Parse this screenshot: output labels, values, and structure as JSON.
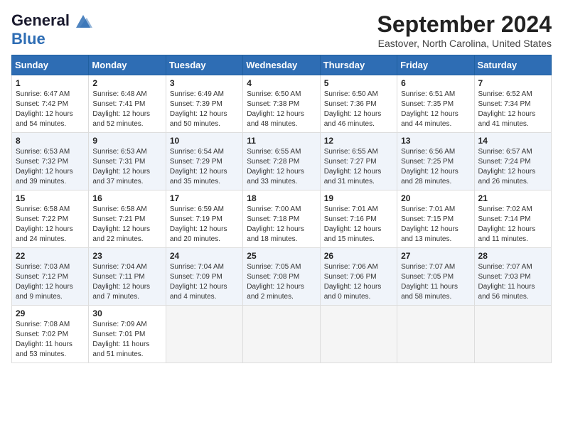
{
  "header": {
    "logo_line1": "General",
    "logo_line2": "Blue",
    "month_year": "September 2024",
    "location": "Eastover, North Carolina, United States"
  },
  "weekdays": [
    "Sunday",
    "Monday",
    "Tuesday",
    "Wednesday",
    "Thursday",
    "Friday",
    "Saturday"
  ],
  "weeks": [
    [
      {
        "day": "1",
        "sunrise": "6:47 AM",
        "sunset": "7:42 PM",
        "daylight": "12 hours and 54 minutes."
      },
      {
        "day": "2",
        "sunrise": "6:48 AM",
        "sunset": "7:41 PM",
        "daylight": "12 hours and 52 minutes."
      },
      {
        "day": "3",
        "sunrise": "6:49 AM",
        "sunset": "7:39 PM",
        "daylight": "12 hours and 50 minutes."
      },
      {
        "day": "4",
        "sunrise": "6:50 AM",
        "sunset": "7:38 PM",
        "daylight": "12 hours and 48 minutes."
      },
      {
        "day": "5",
        "sunrise": "6:50 AM",
        "sunset": "7:36 PM",
        "daylight": "12 hours and 46 minutes."
      },
      {
        "day": "6",
        "sunrise": "6:51 AM",
        "sunset": "7:35 PM",
        "daylight": "12 hours and 44 minutes."
      },
      {
        "day": "7",
        "sunrise": "6:52 AM",
        "sunset": "7:34 PM",
        "daylight": "12 hours and 41 minutes."
      }
    ],
    [
      {
        "day": "8",
        "sunrise": "6:53 AM",
        "sunset": "7:32 PM",
        "daylight": "12 hours and 39 minutes."
      },
      {
        "day": "9",
        "sunrise": "6:53 AM",
        "sunset": "7:31 PM",
        "daylight": "12 hours and 37 minutes."
      },
      {
        "day": "10",
        "sunrise": "6:54 AM",
        "sunset": "7:29 PM",
        "daylight": "12 hours and 35 minutes."
      },
      {
        "day": "11",
        "sunrise": "6:55 AM",
        "sunset": "7:28 PM",
        "daylight": "12 hours and 33 minutes."
      },
      {
        "day": "12",
        "sunrise": "6:55 AM",
        "sunset": "7:27 PM",
        "daylight": "12 hours and 31 minutes."
      },
      {
        "day": "13",
        "sunrise": "6:56 AM",
        "sunset": "7:25 PM",
        "daylight": "12 hours and 28 minutes."
      },
      {
        "day": "14",
        "sunrise": "6:57 AM",
        "sunset": "7:24 PM",
        "daylight": "12 hours and 26 minutes."
      }
    ],
    [
      {
        "day": "15",
        "sunrise": "6:58 AM",
        "sunset": "7:22 PM",
        "daylight": "12 hours and 24 minutes."
      },
      {
        "day": "16",
        "sunrise": "6:58 AM",
        "sunset": "7:21 PM",
        "daylight": "12 hours and 22 minutes."
      },
      {
        "day": "17",
        "sunrise": "6:59 AM",
        "sunset": "7:19 PM",
        "daylight": "12 hours and 20 minutes."
      },
      {
        "day": "18",
        "sunrise": "7:00 AM",
        "sunset": "7:18 PM",
        "daylight": "12 hours and 18 minutes."
      },
      {
        "day": "19",
        "sunrise": "7:01 AM",
        "sunset": "7:16 PM",
        "daylight": "12 hours and 15 minutes."
      },
      {
        "day": "20",
        "sunrise": "7:01 AM",
        "sunset": "7:15 PM",
        "daylight": "12 hours and 13 minutes."
      },
      {
        "day": "21",
        "sunrise": "7:02 AM",
        "sunset": "7:14 PM",
        "daylight": "12 hours and 11 minutes."
      }
    ],
    [
      {
        "day": "22",
        "sunrise": "7:03 AM",
        "sunset": "7:12 PM",
        "daylight": "12 hours and 9 minutes."
      },
      {
        "day": "23",
        "sunrise": "7:04 AM",
        "sunset": "7:11 PM",
        "daylight": "12 hours and 7 minutes."
      },
      {
        "day": "24",
        "sunrise": "7:04 AM",
        "sunset": "7:09 PM",
        "daylight": "12 hours and 4 minutes."
      },
      {
        "day": "25",
        "sunrise": "7:05 AM",
        "sunset": "7:08 PM",
        "daylight": "12 hours and 2 minutes."
      },
      {
        "day": "26",
        "sunrise": "7:06 AM",
        "sunset": "7:06 PM",
        "daylight": "12 hours and 0 minutes."
      },
      {
        "day": "27",
        "sunrise": "7:07 AM",
        "sunset": "7:05 PM",
        "daylight": "11 hours and 58 minutes."
      },
      {
        "day": "28",
        "sunrise": "7:07 AM",
        "sunset": "7:03 PM",
        "daylight": "11 hours and 56 minutes."
      }
    ],
    [
      {
        "day": "29",
        "sunrise": "7:08 AM",
        "sunset": "7:02 PM",
        "daylight": "11 hours and 53 minutes."
      },
      {
        "day": "30",
        "sunrise": "7:09 AM",
        "sunset": "7:01 PM",
        "daylight": "11 hours and 51 minutes."
      },
      null,
      null,
      null,
      null,
      null
    ]
  ]
}
